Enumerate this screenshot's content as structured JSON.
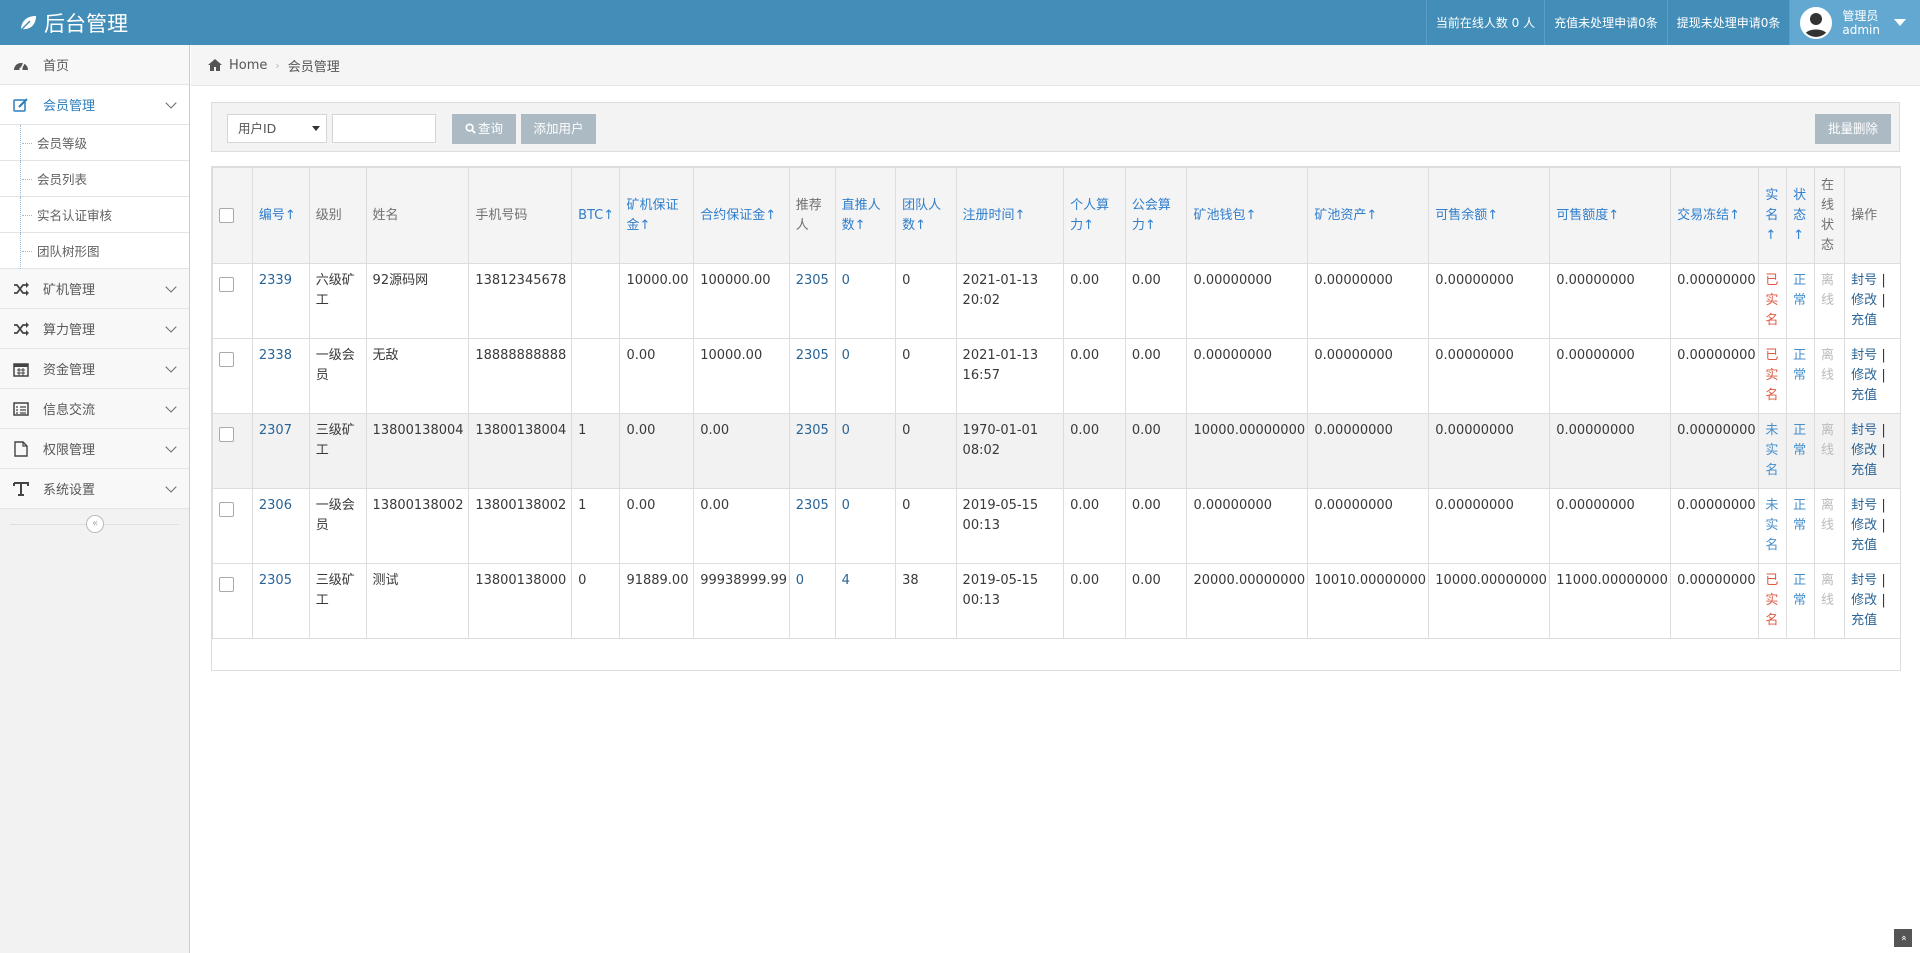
{
  "app": {
    "title": "后台管理"
  },
  "navbar": {
    "online_users": "当前在线人数 0 人",
    "recharge_pending": "充值未处理申请0条",
    "withdraw_pending": "提现未处理申请0条",
    "user_role": "管理员",
    "user_name": "admin"
  },
  "sidebar": {
    "items": [
      {
        "label": "首页",
        "icon": "dashboard-icon"
      },
      {
        "label": "会员管理",
        "icon": "edit-icon"
      },
      {
        "label": "矿机管理",
        "icon": "random-icon"
      },
      {
        "label": "算力管理",
        "icon": "random-icon"
      },
      {
        "label": "资金管理",
        "icon": "calendar-icon"
      },
      {
        "label": "信息交流",
        "icon": "list-icon"
      },
      {
        "label": "权限管理",
        "icon": "file-icon"
      },
      {
        "label": "系统设置",
        "icon": "text-icon"
      }
    ],
    "subitems": [
      {
        "label": "会员等级"
      },
      {
        "label": "会员列表"
      },
      {
        "label": "实名认证审核"
      },
      {
        "label": "团队树形图"
      }
    ],
    "collapse_glyph": "«"
  },
  "breadcrumb": {
    "home": "Home",
    "current": "会员管理"
  },
  "toolbar": {
    "select_value": "用户ID",
    "search_placeholder": "",
    "query_label": "查询",
    "add_label": "添加用户",
    "batch_delete_label": "批量删除"
  },
  "table": {
    "headers": [
      "编号↑",
      "级别",
      "姓名",
      "手机号码",
      "BTC↑",
      "矿机保证金↑",
      "合约保证金↑",
      "推荐人",
      "直推人数↑",
      "团队人数↑",
      "注册时间↑",
      "个人算力↑",
      "公会算力↑",
      "矿池钱包↑",
      "矿池资产↑",
      "可售余额↑",
      "可售额度↑",
      "交易冻结↑",
      "实名↑",
      "状态↑",
      "在线状态",
      "操作"
    ],
    "rows": [
      {
        "id": "2339",
        "level": "六级矿工",
        "name": "92源码网",
        "phone": "13812345678",
        "btc": "",
        "miner_deposit": "10000.00",
        "contract_deposit": "100000.00",
        "referrer": "2305",
        "direct": "0",
        "team": "0",
        "reg_time": "2021-01-13 20:02",
        "personal_power": "0.00",
        "guild_power": "0.00",
        "pool_wallet": "0.00000000",
        "pool_assets": "0.00000000",
        "sellable_balance": "0.00000000",
        "sellable_quota": "0.00000000",
        "frozen": "0.00000000",
        "realname": "已实名",
        "status": "正常",
        "online": "离线"
      },
      {
        "id": "2338",
        "level": "一级会员",
        "name": "无敌",
        "phone": "18888888888",
        "btc": "",
        "miner_deposit": "0.00",
        "contract_deposit": "10000.00",
        "referrer": "2305",
        "direct": "0",
        "team": "0",
        "reg_time": "2021-01-13 16:57",
        "personal_power": "0.00",
        "guild_power": "0.00",
        "pool_wallet": "0.00000000",
        "pool_assets": "0.00000000",
        "sellable_balance": "0.00000000",
        "sellable_quota": "0.00000000",
        "frozen": "0.00000000",
        "realname": "已实名",
        "status": "正常",
        "online": "离线"
      },
      {
        "id": "2307",
        "level": "三级矿工",
        "name": "13800138004",
        "phone": "13800138004",
        "btc": "1",
        "miner_deposit": "0.00",
        "contract_deposit": "0.00",
        "referrer": "2305",
        "direct": "0",
        "team": "0",
        "reg_time": "1970-01-01 08:02",
        "personal_power": "0.00",
        "guild_power": "0.00",
        "pool_wallet": "10000.00000000",
        "pool_assets": "0.00000000",
        "sellable_balance": "0.00000000",
        "sellable_quota": "0.00000000",
        "frozen": "0.00000000",
        "realname": "未实名",
        "status": "正常",
        "online": "离线"
      },
      {
        "id": "2306",
        "level": "一级会员",
        "name": "13800138002",
        "phone": "13800138002",
        "btc": "1",
        "miner_deposit": "0.00",
        "contract_deposit": "0.00",
        "referrer": "2305",
        "direct": "0",
        "team": "0",
        "reg_time": "2019-05-15 00:13",
        "personal_power": "0.00",
        "guild_power": "0.00",
        "pool_wallet": "0.00000000",
        "pool_assets": "0.00000000",
        "sellable_balance": "0.00000000",
        "sellable_quota": "0.00000000",
        "frozen": "0.00000000",
        "realname": "未实名",
        "status": "正常",
        "online": "离线"
      },
      {
        "id": "2305",
        "level": "三级矿工",
        "name": "测试",
        "phone": "13800138000",
        "btc": "0",
        "miner_deposit": "91889.00",
        "contract_deposit": "99938999.99",
        "referrer": "0",
        "direct": "4",
        "team": "38",
        "reg_time": "2019-05-15 00:13",
        "personal_power": "0.00",
        "guild_power": "0.00",
        "pool_wallet": "20000.00000000",
        "pool_assets": "10010.00000000",
        "sellable_balance": "10000.00000000",
        "sellable_quota": "11000.00000000",
        "frozen": "0.00000000",
        "realname": "已实名",
        "status": "正常",
        "online": "离线"
      }
    ],
    "actions": {
      "ban": "封号",
      "edit": "修改",
      "recharge": "充值",
      "sep": "|"
    }
  },
  "scroll_top_glyph": "«"
}
